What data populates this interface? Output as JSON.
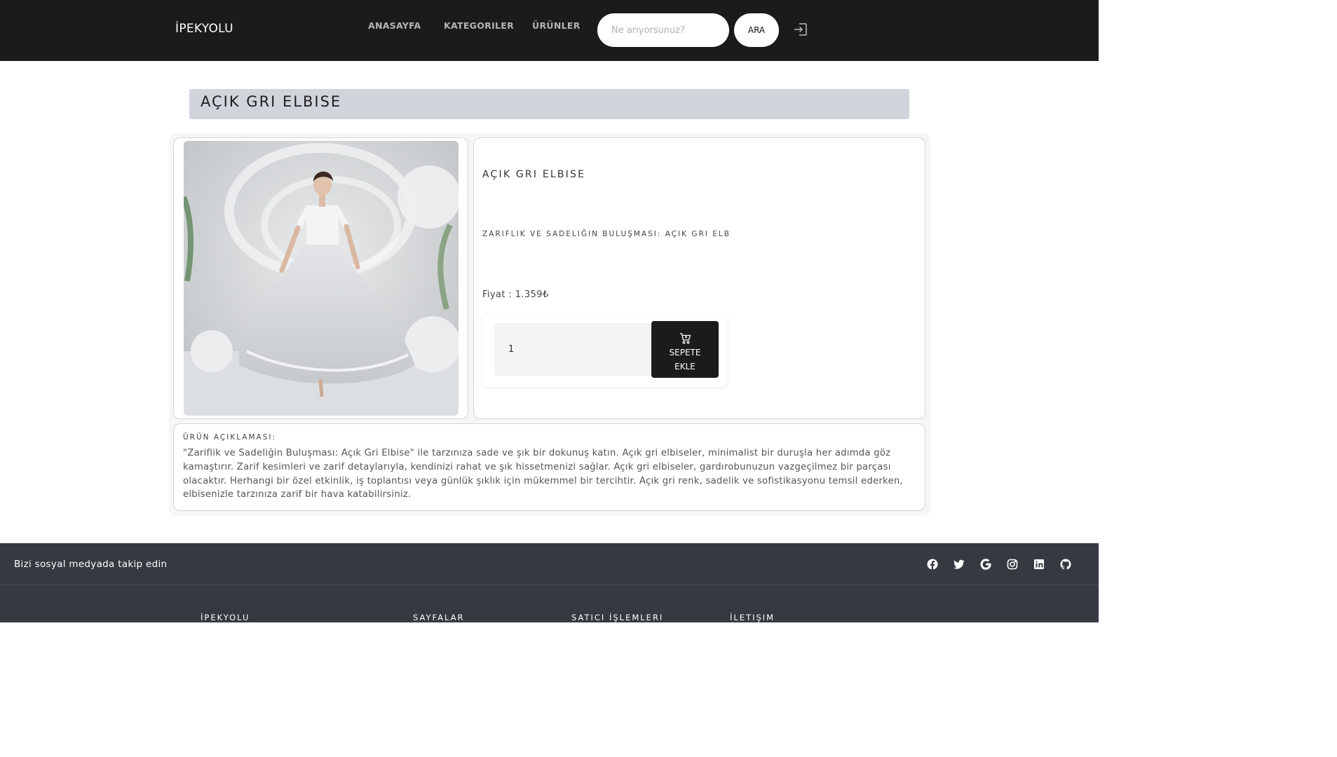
{
  "navbar": {
    "brand": "İPEKYOLU",
    "links": [
      "ANASAYFA",
      "KATEGORILER",
      "ÜRÜNLER"
    ],
    "search_placeholder": "Ne arıyorsunuz?",
    "search_button": "ARA",
    "login_icon": "sign-in-icon"
  },
  "page_title": "AÇIK GRI ELBISE",
  "product": {
    "image_alt": "Açık gri elbise giyen kadın",
    "title": "AÇIK GRI ELBISE",
    "subtitle": "ZARIFLIK VE SADELIĞIN BULUŞMASI: AÇIK GRI ELB",
    "price": "Fiyat : 1.359₺",
    "quantity": "1",
    "add_to_cart_line1": "SEPETE",
    "add_to_cart_line2": "EKLE",
    "cart_icon": "shopping-cart-icon",
    "description_label": "ÜRÜN AÇIKLAMASI:",
    "description": "\"Zariflik ve Sadeliğin Buluşması: Açık Gri Elbise\" ile tarzınıza sade ve şık bir dokunuş katın. Açık gri elbiseler, minimalist bir duruşla her adımda göz kamaştırır. Zarif kesimleri ve zarif detaylarıyla, kendinizi rahat ve şık hissetmenizi sağlar. Açık gri elbiseler, gardırobunuzun vazgeçilmez bir parçası olacaktır. Herhangi bir özel etkinlik, iş toplantısı veya günlük şıklık için mükemmel bir tercihtir. Açık gri renk, sadelik ve sofistikasyonu temsil ederken, elbisenizle tarzınıza zarif bir hava katabilirsiniz."
  },
  "footer": {
    "follow_text": "Bizi sosyal medyada takip edin",
    "social_icons": [
      "facebook-icon",
      "twitter-icon",
      "google-icon",
      "instagram-icon",
      "linkedin-icon",
      "github-icon"
    ],
    "columns": [
      "İPEKYOLU",
      "SAYFALAR",
      "SATICI İŞLEMLERI",
      "İLETIŞIM"
    ]
  },
  "colors": {
    "navbar_bg": "#1b1b1b",
    "title_bar_bg": "#d0d5dc",
    "footer_bg": "#353a41",
    "button_dark": "#1b1b1b"
  }
}
